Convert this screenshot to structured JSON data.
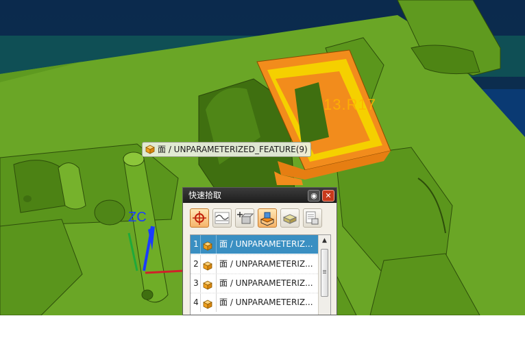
{
  "viewport": {
    "tooltip_text": "面 / UNPARAMETERIZED_FEATURE(9)",
    "dimension_label": "13.R17",
    "axis_label": "ZC",
    "colors": {
      "background_top": "#0b2a4d",
      "background_band": "#0f4f55",
      "model_green": "#6aa626",
      "model_green_dark": "#3f6f10",
      "highlight_orange": "#f28c1c",
      "highlight_yellow": "#f5d000",
      "axis_blue": "#1a3cff"
    }
  },
  "quick_pick": {
    "title": "快速拾取",
    "pin_icon": "pin-icon",
    "close_icon": "close-icon",
    "toolbar": [
      {
        "name": "all-filter-icon",
        "active": true
      },
      {
        "name": "curve-filter-icon",
        "active": false
      },
      {
        "name": "point-filter-icon",
        "active": false
      },
      {
        "name": "face-filter-icon",
        "active": true
      },
      {
        "name": "body-filter-icon",
        "active": false
      },
      {
        "name": "component-filter-icon",
        "active": false
      }
    ],
    "items": [
      {
        "num": "1",
        "text": "面 / UNPARAMETERIZ...",
        "selected": true
      },
      {
        "num": "2",
        "text": "面 / UNPARAMETERIZ...",
        "selected": false
      },
      {
        "num": "3",
        "text": "面 / UNPARAMETERIZ...",
        "selected": false
      },
      {
        "num": "4",
        "text": "面 / UNPARAMETERIZ...",
        "selected": false
      }
    ]
  }
}
